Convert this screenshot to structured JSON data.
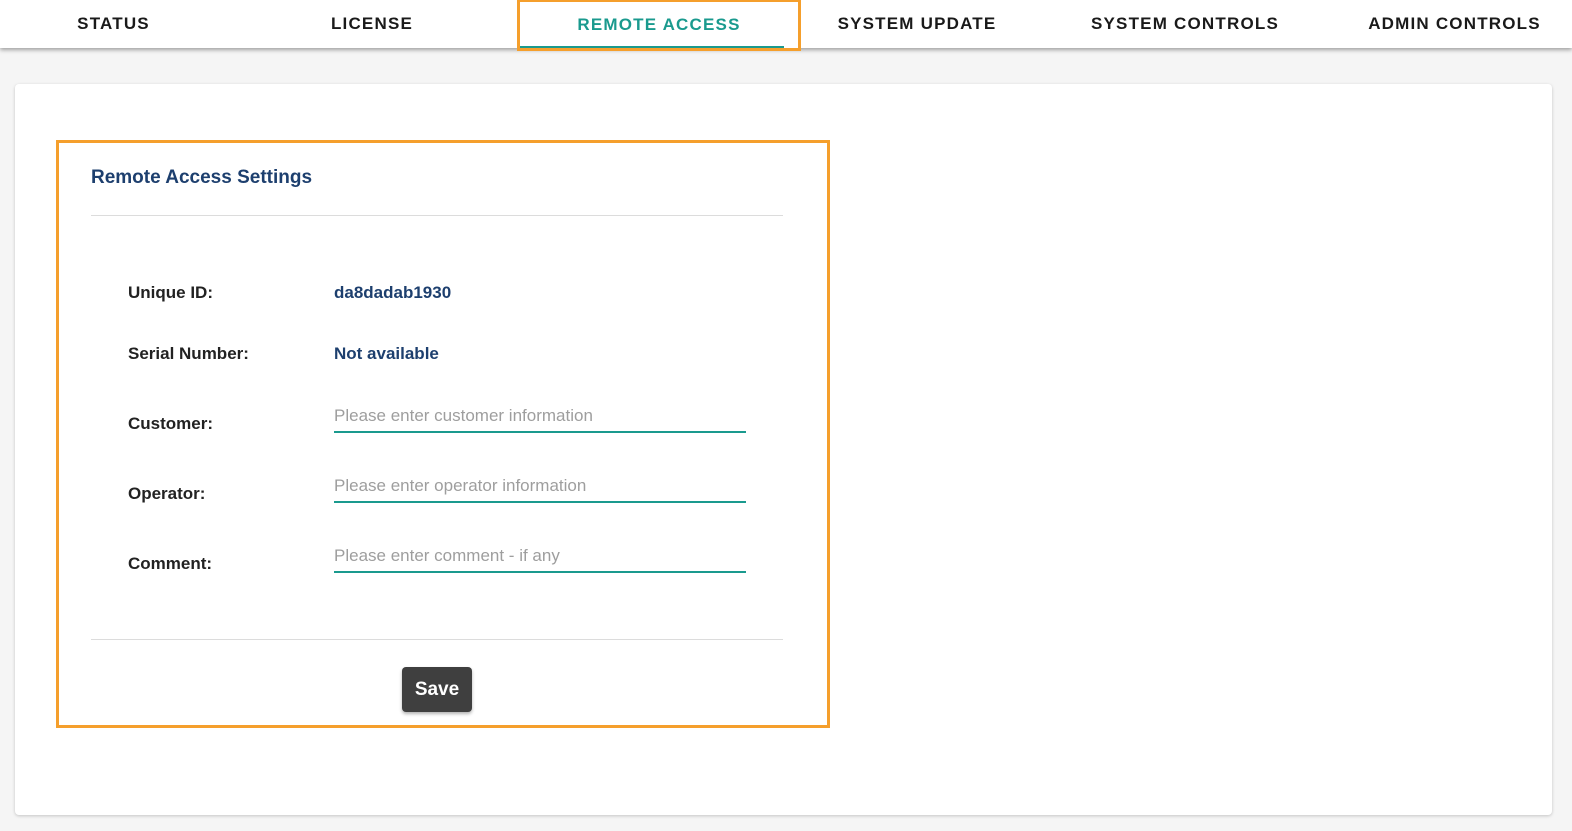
{
  "tabs": [
    {
      "label": "STATUS",
      "active": false
    },
    {
      "label": "LICENSE",
      "active": false
    },
    {
      "label": "REMOTE ACCESS",
      "active": true
    },
    {
      "label": "SYSTEM UPDATE",
      "active": false
    },
    {
      "label": "SYSTEM CONTROLS",
      "active": false
    },
    {
      "label": "ADMIN CONTROLS",
      "active": false
    }
  ],
  "remote_access": {
    "title": "Remote Access Settings",
    "unique_id_label": "Unique ID:",
    "unique_id_value": "da8dadab1930",
    "serial_label": "Serial Number:",
    "serial_value": "Not available",
    "customer_label": "Customer:",
    "customer_value": "",
    "customer_placeholder": "Please enter customer information",
    "operator_label": "Operator:",
    "operator_value": "",
    "operator_placeholder": "Please enter operator information",
    "comment_label": "Comment:",
    "comment_value": "",
    "comment_placeholder": "Please enter comment - if any",
    "save_label": "Save"
  },
  "colors": {
    "accent": "#1a9a8e",
    "highlight": "#f59f2c",
    "title": "#1d3f6e",
    "button": "#3f3f3f"
  }
}
